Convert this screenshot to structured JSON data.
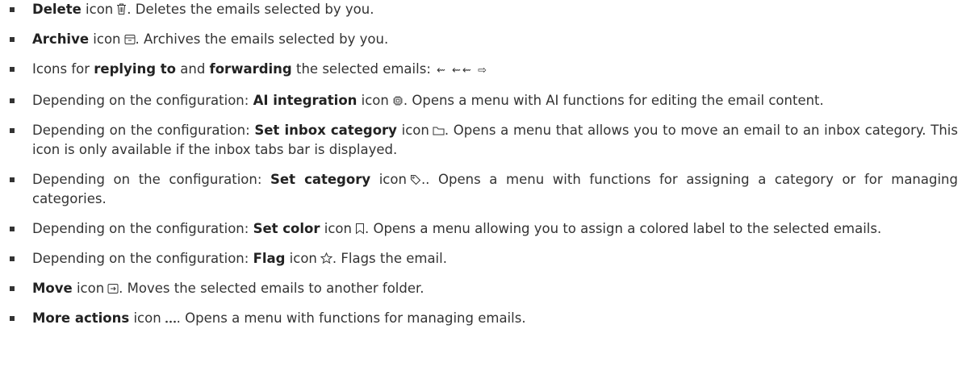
{
  "items": [
    {
      "pre": "",
      "b1": "Delete",
      "mid": " icon",
      "icon": "delete-icon",
      "post": ". Deletes the emails selected by you."
    },
    {
      "pre": "",
      "b1": "Archive",
      "mid": " icon",
      "icon": "archive-icon",
      "post": ". Archives the emails selected by you."
    },
    {
      "pre": "Icons for ",
      "b1": "replying to",
      "mid": " and ",
      "b2": "forwarding",
      "mid2": " the selected emails: ",
      "glyphs": "⇜ ⇜⇜ ⇨",
      "icon_names": [
        "reply-icon",
        "reply-all-icon",
        "forward-icon"
      ]
    },
    {
      "pre": "Depending on the configuration: ",
      "b1": "AI integration",
      "mid": " icon",
      "icon": "ai-chip-icon",
      "post": ". Opens a menu with AI functions for editing the email content."
    },
    {
      "pre": "Depending on the configuration: ",
      "b1": "Set inbox category",
      "mid": " icon",
      "icon": "folder-icon",
      "post": ". Opens a menu that allows you to move an email to an inbox category. This icon is only available if the inbox tabs bar is displayed."
    },
    {
      "pre": "Depending on the configuration: ",
      "b1": "Set category",
      "mid": " icon",
      "icon": "tag-icon",
      "post": ".. Opens a menu with functions for assigning a category or for managing categories."
    },
    {
      "pre": "Depending on the configuration: ",
      "b1": "Set color",
      "mid": " icon",
      "icon": "bookmark-icon",
      "post": ". Opens a menu allowing you to assign a colored label to the selected emails."
    },
    {
      "pre": "Depending on the configuration: ",
      "b1": "Flag",
      "mid": " icon",
      "icon": "star-icon",
      "post": ". Flags the email."
    },
    {
      "pre": "",
      "b1": "Move",
      "mid": " icon",
      "icon": "move-folder-icon",
      "post": ". Moves the selected emails to another folder."
    },
    {
      "pre": "",
      "b1": "More actions",
      "mid": " icon",
      "icon": "more-icon",
      "post": ". Opens a menu with functions for managing emails."
    }
  ]
}
